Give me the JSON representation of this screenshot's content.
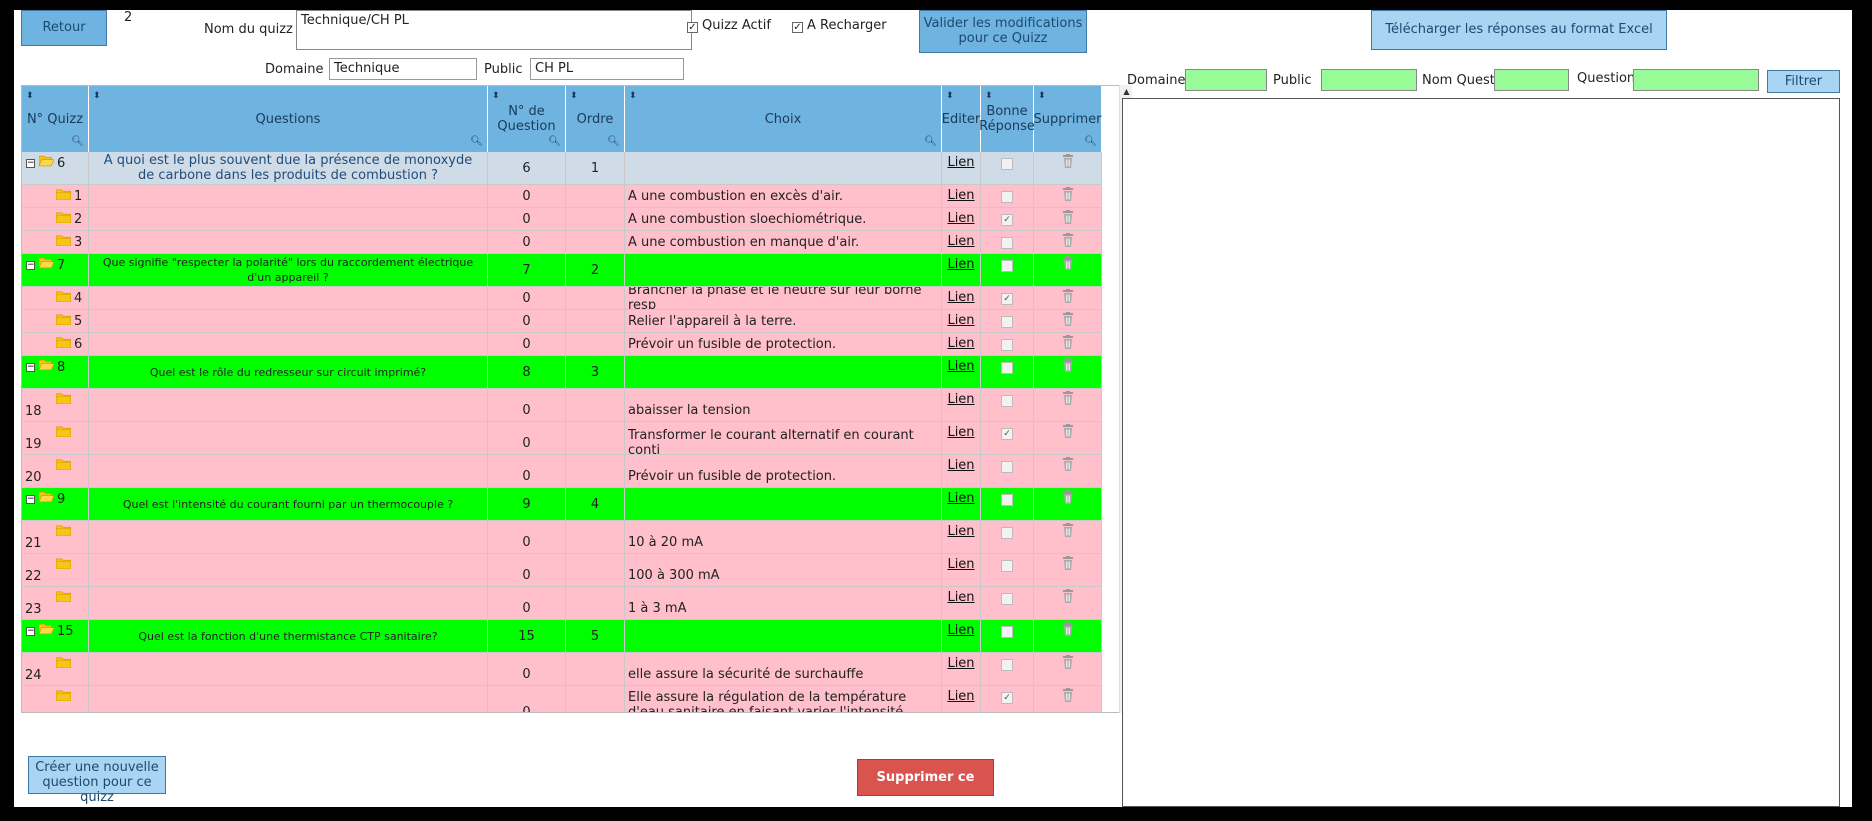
{
  "top": {
    "back_label": "Retour",
    "quizz_number": "2",
    "quizz_name_label": "Nom du quizz",
    "quizz_name_value": "Technique/CH PL",
    "active_label": "Quizz Actif",
    "reload_label": "A Recharger",
    "validate_label_1": "Valider les modifications",
    "validate_label_2": "pour ce Quizz",
    "excel_label": "Télécharger les réponses au format Excel",
    "domain_label": "Domaine",
    "domain_value": "Technique",
    "public_label": "Public",
    "public_value": "CH PL"
  },
  "filters": {
    "domain_label": "Domaine",
    "public_label": "Public",
    "name_label": "Nom Quest",
    "question_label": "Question",
    "filter_button": "Filtrer"
  },
  "grid": {
    "headers": {
      "quizz": "N° Quizz",
      "questions": "Questions",
      "num_q1": "N° de",
      "num_q2": "Question",
      "ordre": "Ordre",
      "choix": "Choix",
      "editer": "Editer",
      "bonne1": "Bonne",
      "bonne2": "Réponse",
      "supprimer": "Supprimer"
    },
    "link_label": "Lien",
    "rows": [
      {
        "kind": "header",
        "id": "6",
        "question": "A quoi est le plus souvent due la présence de monoxyde de carbone dans les produits de combustion ?",
        "num": "6",
        "ordre": "1",
        "choix": "",
        "checked": false
      },
      {
        "kind": "leaf",
        "id": "1",
        "num": "0",
        "choix": "A une combustion en excès d'air.",
        "checked": false
      },
      {
        "kind": "leaf",
        "id": "2",
        "num": "0",
        "choix": "A une combustion sloechiométrique.",
        "checked": true
      },
      {
        "kind": "leaf",
        "id": "3",
        "num": "0",
        "choix": "A une combustion en manque d'air.",
        "checked": false
      },
      {
        "kind": "green",
        "id": "7",
        "question": "Que signifie \"respecter la polarité\" lors du raccordement électrique d'un appareil ?",
        "num": "7",
        "ordre": "2",
        "choix": "",
        "checked": false
      },
      {
        "kind": "leaf",
        "id": "4",
        "num": "0",
        "choix": "Brancher la phase et le neutre sur leur borne resp",
        "checked": true
      },
      {
        "kind": "leaf",
        "id": "5",
        "num": "0",
        "choix": "Relier l'appareil à la terre.",
        "checked": false
      },
      {
        "kind": "leaf",
        "id": "6",
        "num": "0",
        "choix": "Prévoir un fusible de protection.",
        "checked": false
      },
      {
        "kind": "green",
        "id": "8",
        "question": "Quel est le rôle du redresseur sur circuit imprimé?",
        "num": "8",
        "ordre": "3",
        "choix": "",
        "checked": false
      },
      {
        "kind": "leaf2",
        "id": "18",
        "num": "0",
        "choix": "abaisser la tension",
        "checked": false
      },
      {
        "kind": "leaf2",
        "id": "19",
        "num": "0",
        "choix": "Transformer le courant alternatif en courant conti",
        "checked": true
      },
      {
        "kind": "leaf2",
        "id": "20",
        "num": "0",
        "choix": "Prévoir un fusible de protection.",
        "checked": false
      },
      {
        "kind": "green",
        "id": "9",
        "question": "Quel est l'intensité du courant fourni par un thermocouple ?",
        "num": "9",
        "ordre": "4",
        "choix": "",
        "checked": false
      },
      {
        "kind": "leaf2",
        "id": "21",
        "num": "0",
        "choix": "10 à 20 mA",
        "checked": false
      },
      {
        "kind": "leaf2",
        "id": "22",
        "num": "0",
        "choix": "100 à 300 mA",
        "checked": false
      },
      {
        "kind": "leaf2",
        "id": "23",
        "num": "0",
        "choix": "1 à 3 mA",
        "checked": false
      },
      {
        "kind": "green",
        "id": "15",
        "question": "Quel est la fonction d'une thermistance CTP sanitaire?",
        "num": "15",
        "ordre": "5",
        "choix": "",
        "checked": false
      },
      {
        "kind": "leaf2",
        "id": "24",
        "num": "0",
        "choix": "elle assure la sécurité de surchauffe",
        "checked": false
      },
      {
        "kind": "leaf2",
        "id": "25",
        "num": "0",
        "choix": "Elle assure la régulation de la température d'eau sanitaire en faisant varier l'intensité éléctrique délivrée à l'électrovanne.",
        "checked": true
      }
    ]
  },
  "bottom": {
    "create_label_1": "Créer une nouvelle",
    "create_label_2": "question pour ce quizz",
    "delete_label": "Supprimer ce quizz"
  }
}
